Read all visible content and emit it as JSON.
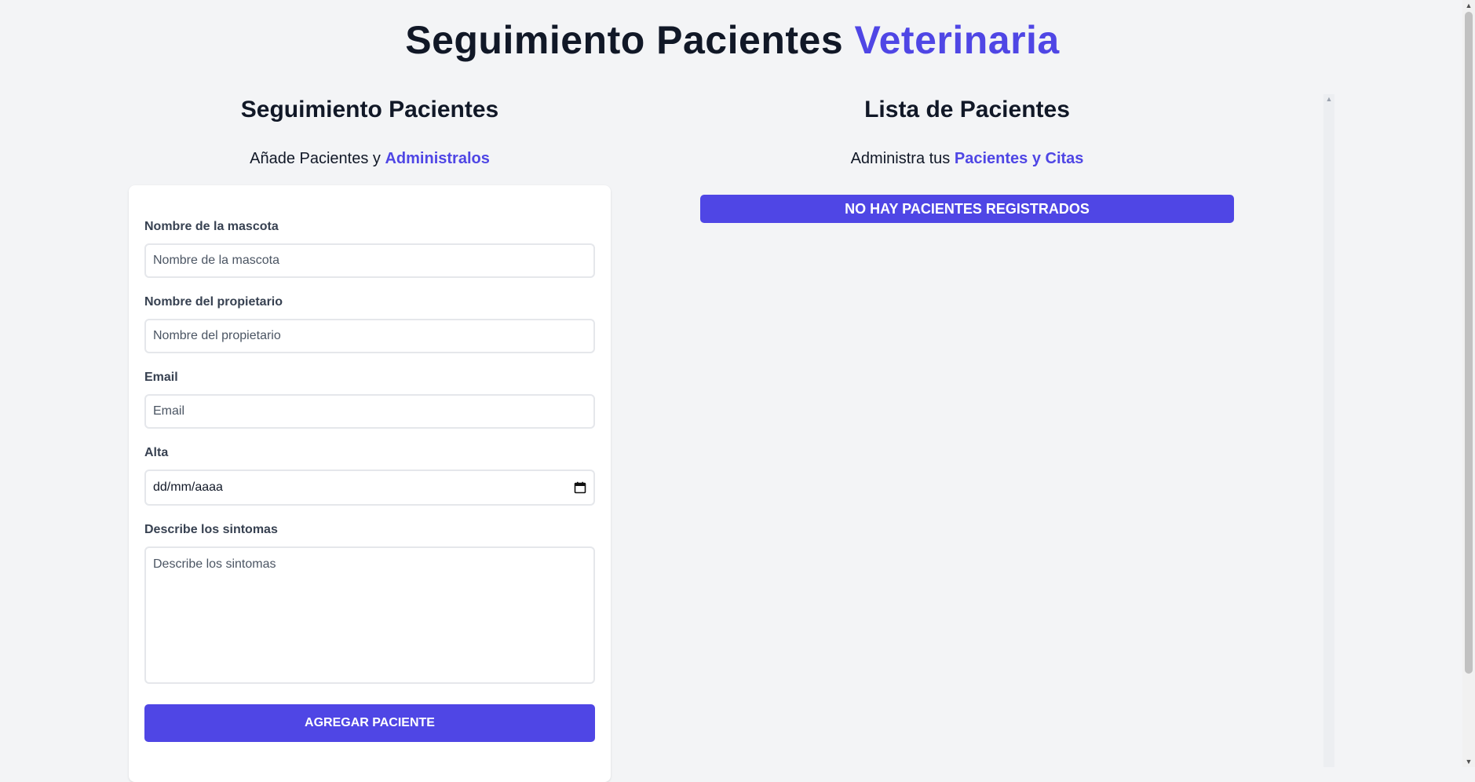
{
  "header": {
    "title_main": "Seguimiento Pacientes",
    "title_accent": "Veterinaria"
  },
  "form_section": {
    "heading": "Seguimiento Pacientes",
    "sub_text": "Añade Pacientes y",
    "sub_accent": "Administralos",
    "fields": {
      "pet_name": {
        "label": "Nombre de la mascota",
        "placeholder": "Nombre de la mascota"
      },
      "owner_name": {
        "label": "Nombre del propietario",
        "placeholder": "Nombre del propietario"
      },
      "email": {
        "label": "Email",
        "placeholder": "Email"
      },
      "discharge": {
        "label": "Alta",
        "value": "dd/mm/aaaa"
      },
      "symptoms": {
        "label": "Describe los sintomas",
        "placeholder": "Describe los sintomas"
      }
    },
    "submit_label": "AGREGAR PACIENTE"
  },
  "list_section": {
    "heading": "Lista de Pacientes",
    "sub_text": "Administra tus",
    "sub_accent": "Pacientes y Citas",
    "empty_message": "NO HAY PACIENTES REGISTRADOS"
  },
  "colors": {
    "accent": "#4f46e5",
    "background": "#f3f4f6",
    "card": "#ffffff"
  },
  "icons": {
    "date_picker": "calendar-icon",
    "scroll_up": "caret-up-icon",
    "scroll_down": "caret-down-icon"
  }
}
